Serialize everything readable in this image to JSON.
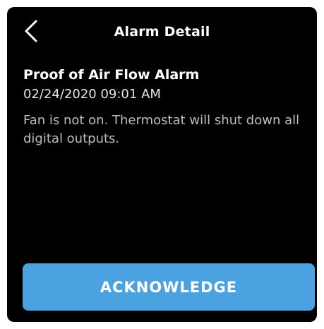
{
  "header": {
    "title": "Alarm Detail",
    "back_icon": "chevron-left-icon"
  },
  "alarm": {
    "name": "Proof of Air Flow Alarm",
    "timestamp": "02/24/2020 09:01 AM",
    "description": "Fan is not on. Thermostat will shut down all digital outputs."
  },
  "actions": {
    "acknowledge_label": "ACKNOWLEDGE"
  },
  "colors": {
    "background": "#000000",
    "accent": "#4aa3e0",
    "text": "#ffffff",
    "muted_text": "#bdbdbd"
  }
}
